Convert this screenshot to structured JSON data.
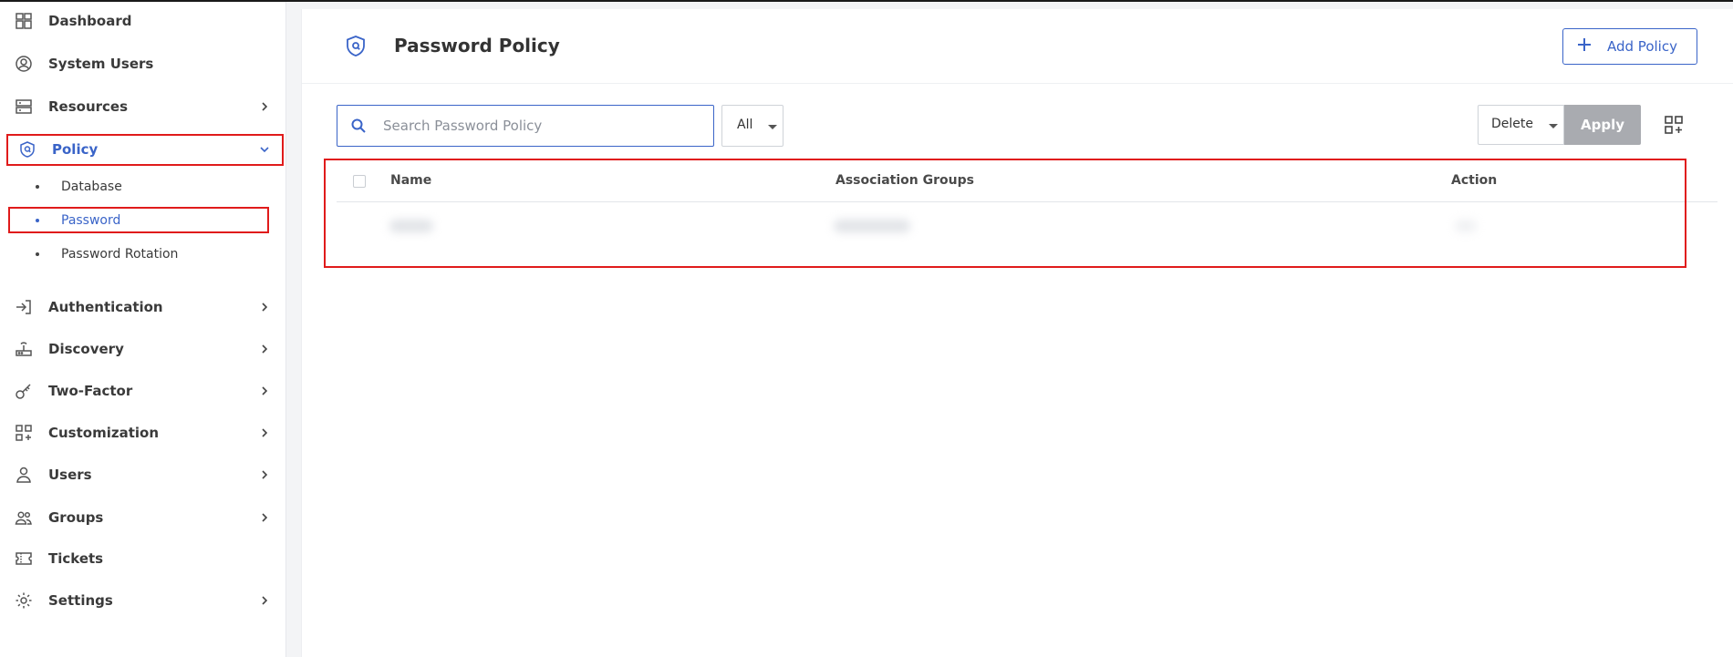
{
  "sidebar": {
    "items": [
      {
        "label": "Dashboard",
        "icon": "dashboard-icon"
      },
      {
        "label": "System Users",
        "icon": "user-circle-icon"
      },
      {
        "label": "Resources",
        "icon": "server-icon"
      },
      {
        "label": "Policy",
        "icon": "shield-icon"
      },
      {
        "label": "Authentication",
        "icon": "sign-in-icon"
      },
      {
        "label": "Discovery",
        "icon": "router-icon"
      },
      {
        "label": "Two-Factor",
        "icon": "key-icon"
      },
      {
        "label": "Customization",
        "icon": "widgets-icon"
      },
      {
        "label": "Users",
        "icon": "user-icon"
      },
      {
        "label": "Groups",
        "icon": "group-icon"
      },
      {
        "label": "Tickets",
        "icon": "ticket-icon"
      },
      {
        "label": "Settings",
        "icon": "gear-icon"
      }
    ],
    "policy_sub": [
      {
        "label": "Database"
      },
      {
        "label": "Password"
      },
      {
        "label": "Password Rotation"
      }
    ]
  },
  "header": {
    "title": "Password Policy",
    "add_label": "Add Policy"
  },
  "toolbar": {
    "search_placeholder": "Search Password Policy",
    "filter_value": "All",
    "bulk_action": "Delete",
    "apply_label": "Apply"
  },
  "table": {
    "columns": [
      "Name",
      "Association Groups",
      "Action"
    ]
  },
  "colors": {
    "accent": "#3a64c8",
    "highlight": "#e01b1b",
    "disabled": "#a9abb0"
  }
}
